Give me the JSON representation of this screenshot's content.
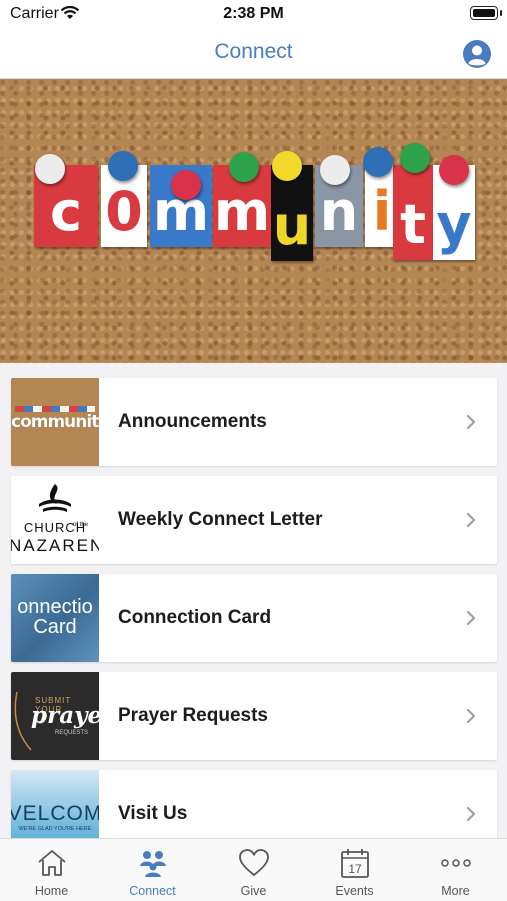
{
  "status_bar": {
    "carrier": "Carrier",
    "time": "2:38 PM"
  },
  "nav": {
    "title": "Connect"
  },
  "hero": {
    "letters": [
      "c",
      "0",
      "m",
      "m",
      "u",
      "n",
      "i",
      "t",
      "y"
    ]
  },
  "list": [
    {
      "label": "Announcements",
      "thumb_text": "community"
    },
    {
      "label": "Weekly Connect Letter",
      "thumb_text": [
        "CHURCH",
        "of the",
        "NAZAREN"
      ]
    },
    {
      "label": "Connection Card",
      "thumb_text": [
        "onnectio",
        "Card"
      ]
    },
    {
      "label": "Prayer Requests",
      "thumb_text": [
        "SUBMIT YOUR",
        "praye",
        "REQUESTS"
      ]
    },
    {
      "label": "Visit Us",
      "thumb_text": [
        "VELCOM",
        "WE'RE GLAD YOU'RE HERE"
      ]
    }
  ],
  "tabbar": {
    "items": [
      {
        "label": "Home",
        "icon": "home-icon"
      },
      {
        "label": "Connect",
        "icon": "people-icon"
      },
      {
        "label": "Give",
        "icon": "heart-icon"
      },
      {
        "label": "Events",
        "icon": "calendar-icon",
        "day": "17"
      },
      {
        "label": "More",
        "icon": "more-icon"
      }
    ],
    "active": "Connect"
  },
  "colors": {
    "accent": "#4a7cc2",
    "cork": "#b48654"
  }
}
